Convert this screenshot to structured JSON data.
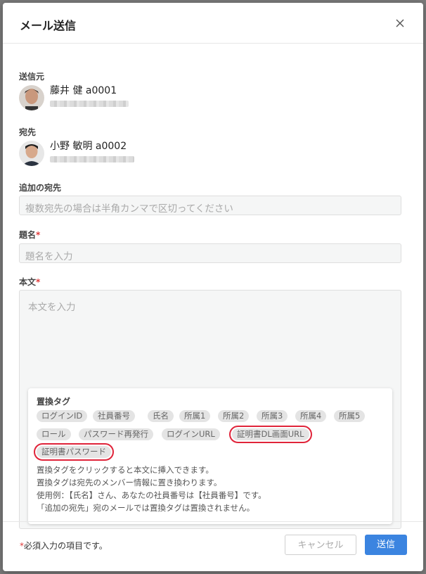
{
  "modal": {
    "title": "メール送信"
  },
  "sender": {
    "label": "送信元",
    "name": "藤井 健 a0001"
  },
  "recipient": {
    "label": "宛先",
    "name": "小野 敏明 a0002"
  },
  "additional": {
    "label": "追加の宛先",
    "placeholder": "複数宛先の場合は半角カンマで区切ってください"
  },
  "subject": {
    "label": "題名",
    "required": "*",
    "placeholder": "題名を入力"
  },
  "body": {
    "label": "本文",
    "required": "*",
    "placeholder": "本文を入力"
  },
  "tags": {
    "title": "置換タグ",
    "items": [
      "ログインID",
      "社員番号",
      "氏名",
      "所属1",
      "所属2",
      "所属3",
      "所属4",
      "所属5",
      "ロール",
      "パスワード再発行",
      "ログインURL",
      "証明書DL画面URL",
      "証明書パスワード"
    ],
    "notes": [
      "置換タグをクリックすると本文に挿入できます。",
      "置換タグは宛先のメンバー情報に置き換わります。",
      "使用例：【氏名】さん、あなたの社員番号は【社員番号】です。",
      "「追加の宛先」宛のメールでは置換タグは置換されません。"
    ]
  },
  "footer": {
    "required_mark": "*",
    "required_note": "必須入力の項目です。",
    "cancel_label": "キャンセル",
    "send_label": "送信"
  },
  "colors": {
    "accent": "#3b84e0",
    "required": "#e03b3b",
    "highlight": "#e0243a"
  }
}
